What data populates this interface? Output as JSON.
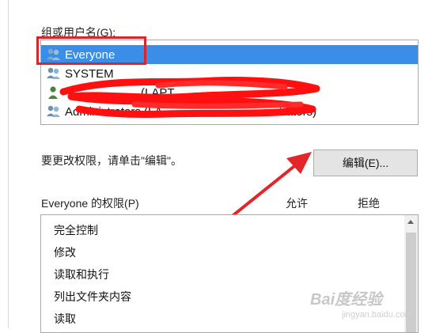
{
  "groups_label": "组或用户名(G):",
  "users": [
    {
      "name": "Everyone",
      "icon": "group-icon",
      "selected": true
    },
    {
      "name": "SYSTEM",
      "icon": "group-icon",
      "selected": false
    },
    {
      "name": "(LAPT",
      "icon": "user-icon",
      "selected": false,
      "redacted": true
    },
    {
      "name": "Administrators (LA",
      "suffix": "nistrators)",
      "icon": "group-icon",
      "selected": false
    }
  ],
  "change_hint": "要更改权限，请单击\"编辑\"。",
  "edit_button_label": "编辑(E)...",
  "permissions_title": "Everyone 的权限(P)",
  "allow_label": "允许",
  "deny_label": "拒绝",
  "permissions": [
    "完全控制",
    "修改",
    "读取和执行",
    "列出文件夹内容",
    "读取"
  ],
  "watermark": "Bai度经验",
  "watermark_sub": "jingyan.baidu.com",
  "colors": {
    "selection": "#3b8ee8",
    "annotation": "#d9262c"
  }
}
